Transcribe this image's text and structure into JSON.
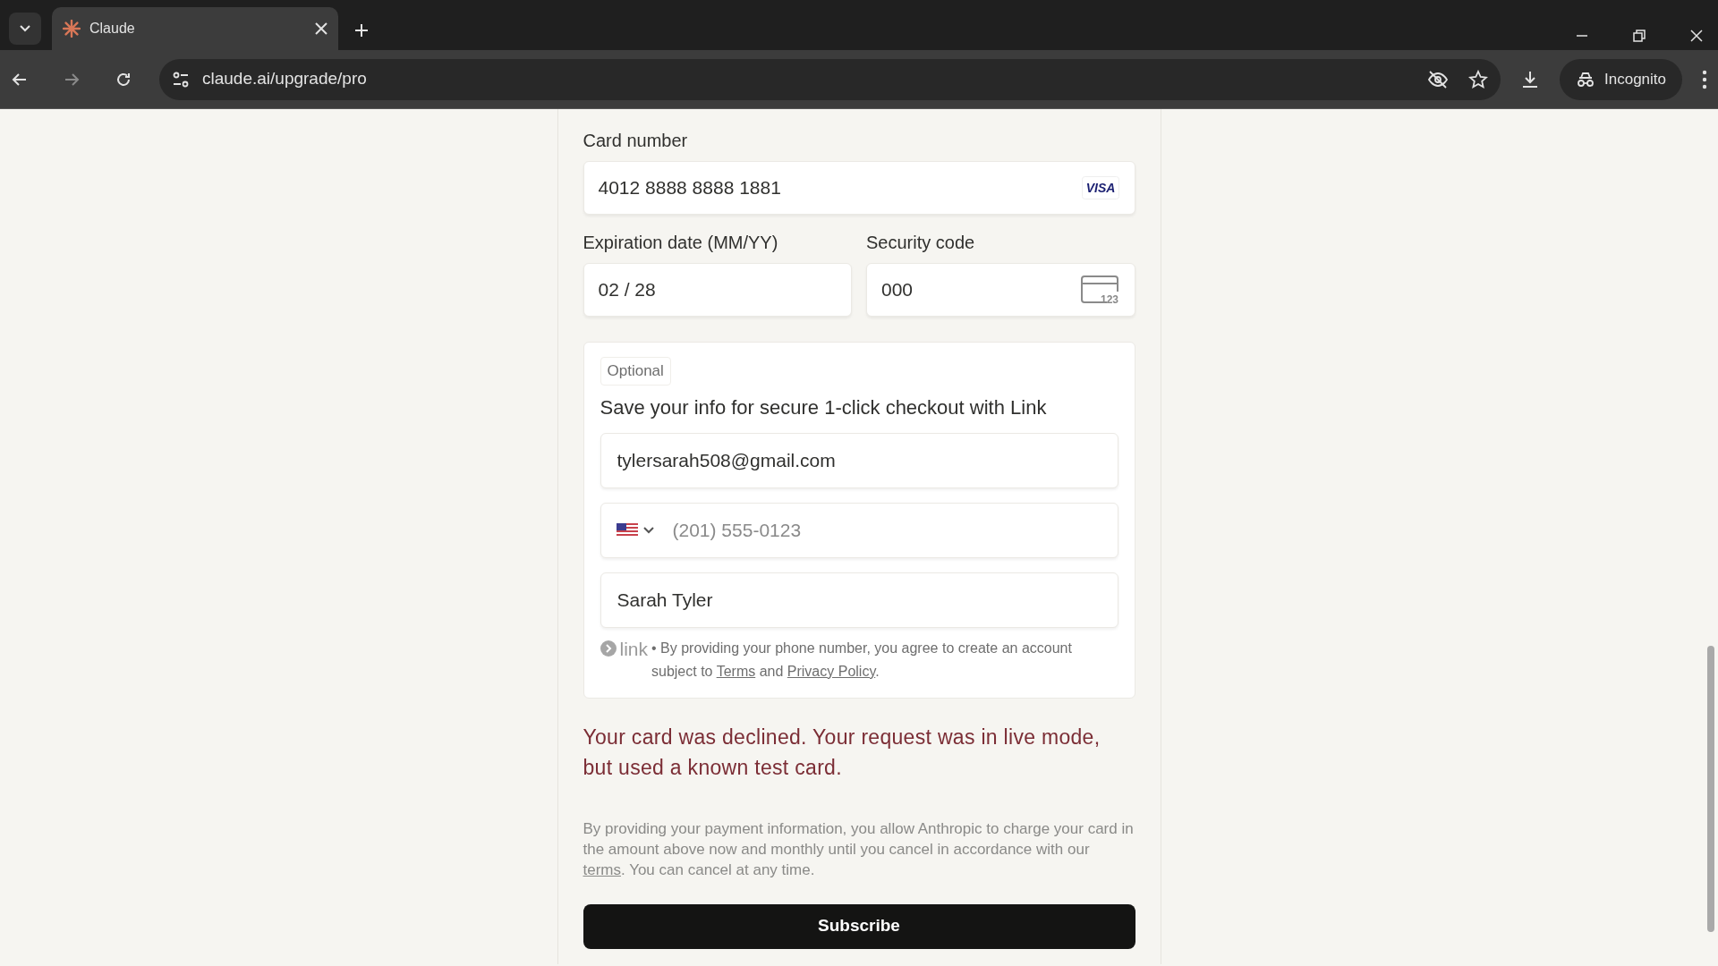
{
  "browser": {
    "tab_title": "Claude",
    "url": "claude.ai/upgrade/pro",
    "profile_label": "Incognito"
  },
  "card_number": {
    "label": "Card number",
    "value": "4012 8888 8888 1881",
    "brand": "VISA"
  },
  "expiration": {
    "label": "Expiration date (MM/YY)",
    "value": "02 / 28"
  },
  "security_code": {
    "label": "Security code",
    "value": "000",
    "icon_text": "123"
  },
  "link_section": {
    "badge": "Optional",
    "heading": "Save your info for secure 1-click checkout with Link",
    "email": {
      "value": "tylersarah508@gmail.com"
    },
    "phone": {
      "placeholder": "(201) 555-0123"
    },
    "name": {
      "value": "Sarah Tyler"
    },
    "logo_text": "link",
    "consent": [
      {
        "kind": "text",
        "text": "• By providing your phone number, you agree to create an account subject to "
      },
      {
        "kind": "link",
        "text": "Terms"
      },
      {
        "kind": "text",
        "text": " and "
      },
      {
        "kind": "link",
        "text": "Privacy Policy"
      },
      {
        "kind": "text",
        "text": "."
      }
    ]
  },
  "error_message": "Your card was declined. Your request was in live mode, but used a known test card.",
  "disclaimer": [
    {
      "kind": "text",
      "text": "By providing your payment information, you allow Anthropic to charge your card in the amount above now and monthly until you cancel in accordance with our "
    },
    {
      "kind": "link",
      "text": "terms"
    },
    {
      "kind": "text",
      "text": ". You can cancel at any time."
    }
  ],
  "subscribe_button": "Subscribe"
}
